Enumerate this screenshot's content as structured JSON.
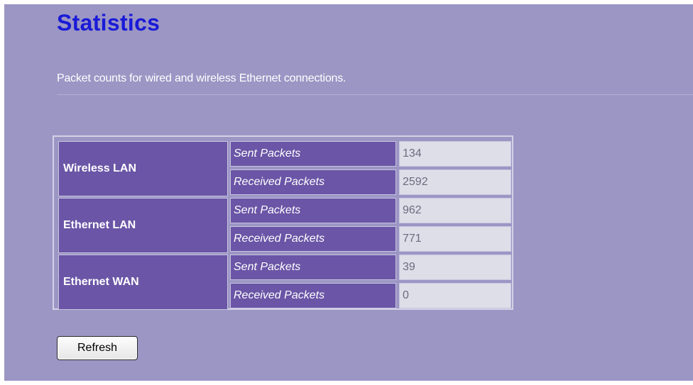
{
  "page": {
    "title": "Statistics",
    "description": "Packet counts  for wired and wireless Ethernet connections."
  },
  "stats": {
    "groups": [
      {
        "name": "Wireless LAN",
        "rows": [
          {
            "label": "Sent Packets",
            "value": "134"
          },
          {
            "label": "Received Packets",
            "value": "2592"
          }
        ]
      },
      {
        "name": "Ethernet LAN",
        "rows": [
          {
            "label": "Sent Packets",
            "value": "962"
          },
          {
            "label": "Received Packets",
            "value": "771"
          }
        ]
      },
      {
        "name": "Ethernet WAN",
        "rows": [
          {
            "label": "Sent Packets",
            "value": "39"
          },
          {
            "label": "Received Packets",
            "value": "0"
          }
        ]
      }
    ]
  },
  "actions": {
    "refresh_label": "Refresh"
  },
  "colors": {
    "panel_bg": "#9b96c4",
    "title": "#1a1ad8",
    "header_cell": "#6a55a6",
    "value_cell": "#dedee8"
  }
}
